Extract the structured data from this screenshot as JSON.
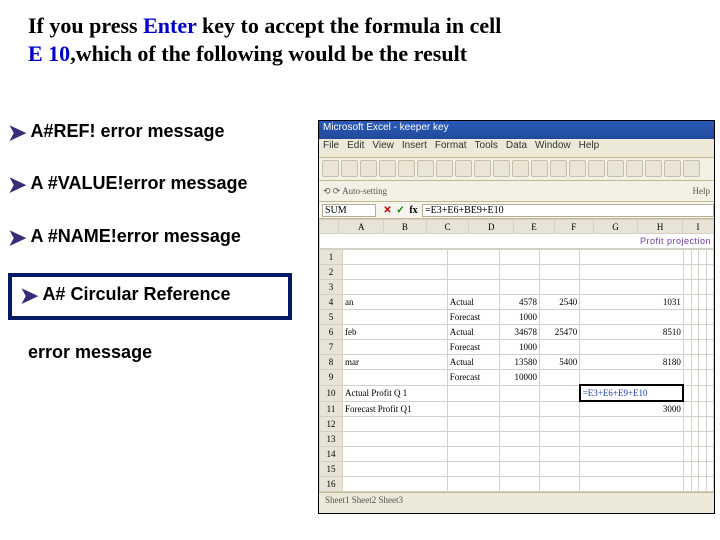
{
  "question": {
    "line1_pre": "If you press ",
    "enter": "Enter",
    "line1_post": " key to accept the formula in cell",
    "line2_pre": " ",
    "cell": "E 10",
    "line2_post": ",which of the following would be the result"
  },
  "options": {
    "a": "A#REF! error message",
    "b": "A #VALUE!error message",
    "c": "A #NAME!error message",
    "d1": "A# Circular Reference",
    "d2": "error message"
  },
  "excel": {
    "title": "Microsoft Excel - keeper key",
    "menu": [
      "File",
      "Edit",
      "View",
      "Insert",
      "Format",
      "Tools",
      "Data",
      "Window",
      "Help"
    ],
    "toolbar2_left": "⟲ ⟳  Auto-setting",
    "toolbar2_right": "Help",
    "namebox": "SUM",
    "formula": "=E3+E6+BE9+E10",
    "banner": "Profit projection",
    "cols": [
      "",
      "A",
      "B",
      "C",
      "D",
      "E",
      "F",
      "G",
      "H",
      "I"
    ],
    "rows": [
      {
        "n": "1",
        "cells": [
          "",
          "",
          "",
          "",
          "",
          "",
          "",
          "",
          ""
        ]
      },
      {
        "n": "2",
        "cells": [
          "",
          "",
          "",
          "",
          "",
          "",
          "",
          "",
          ""
        ]
      },
      {
        "n": "3",
        "cells": [
          "",
          "",
          "",
          "",
          "",
          "",
          "",
          "",
          ""
        ]
      },
      {
        "n": "4",
        "cells": [
          "an",
          "Actual",
          "4578",
          "2540",
          "1031",
          "",
          "",
          "",
          ""
        ]
      },
      {
        "n": "5",
        "cells": [
          "",
          "Forecast",
          "1000",
          "",
          "",
          "",
          "",
          "",
          ""
        ]
      },
      {
        "n": "6",
        "cells": [
          "feb",
          "Actual",
          "34678",
          "25470",
          "8510",
          "",
          "",
          "",
          ""
        ]
      },
      {
        "n": "7",
        "cells": [
          "",
          "Forecast",
          "1000",
          "",
          "",
          "",
          "",
          "",
          ""
        ]
      },
      {
        "n": "8",
        "cells": [
          "mar",
          "Actual",
          "13580",
          "5400",
          "8180",
          "",
          "",
          "",
          ""
        ]
      },
      {
        "n": "9",
        "cells": [
          "",
          "Forecast",
          "10000",
          "",
          "",
          "",
          "",
          "",
          ""
        ]
      },
      {
        "n": "10",
        "cells": [
          "Actual Profit Q 1",
          "",
          "",
          "",
          "=E3+E6+E9+E10",
          "",
          "",
          "",
          ""
        ]
      },
      {
        "n": "11",
        "cells": [
          "Forecast Profit Q1",
          "",
          "",
          "",
          "3000",
          "",
          "",
          "",
          ""
        ]
      },
      {
        "n": "12",
        "cells": [
          "",
          "",
          "",
          "",
          "",
          "",
          "",
          "",
          ""
        ]
      },
      {
        "n": "13",
        "cells": [
          "",
          "",
          "",
          "",
          "",
          "",
          "",
          "",
          ""
        ]
      },
      {
        "n": "14",
        "cells": [
          "",
          "",
          "",
          "",
          "",
          "",
          "",
          "",
          ""
        ]
      },
      {
        "n": "15",
        "cells": [
          "",
          "",
          "",
          "",
          "",
          "",
          "",
          "",
          ""
        ]
      },
      {
        "n": "16",
        "cells": [
          "",
          "",
          "",
          "",
          "",
          "",
          "",
          "",
          ""
        ]
      }
    ],
    "tabs": "Sheet1  Sheet2  Sheet3"
  }
}
